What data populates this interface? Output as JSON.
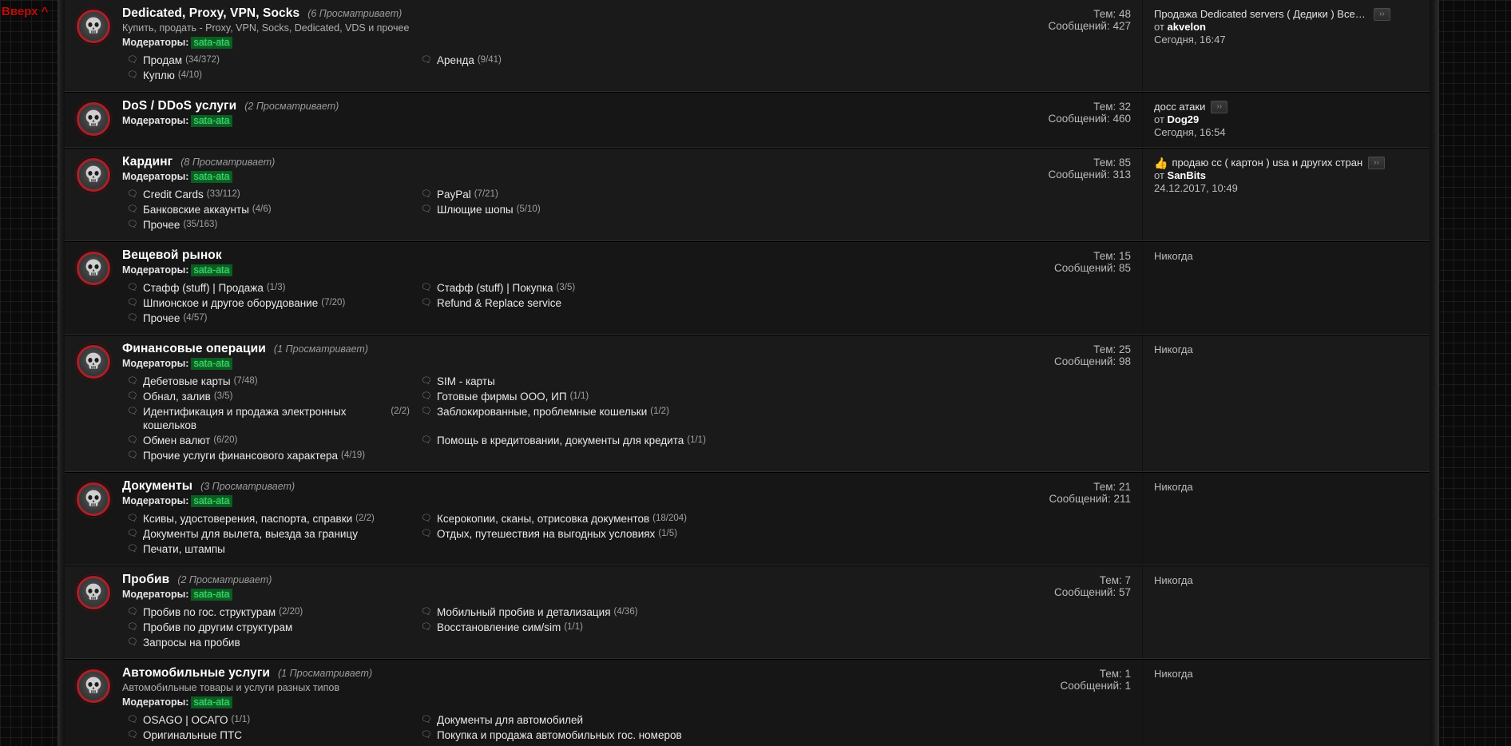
{
  "page": {
    "back_to_top": "Вверх ^",
    "viewers_suffix": "Просматривает",
    "mods_label": "Модераторы:",
    "threads_label": "Тем:",
    "posts_label": "Сообщений:",
    "by_label": "от",
    "never_label": "Никогда",
    "goto_last": "››",
    "accent_red": "#c10b0b",
    "mod_green": "#3be06b",
    "avatar_ring": "#a4232a"
  },
  "forums": [
    {
      "title": "Dedicated, Proxy, VPN, Socks",
      "viewers": "(6 Просматривает)",
      "desc": "Купить, продать - Proxy, VPN, Socks, Dedicated, VDS и прочее",
      "mods": "sata-ata",
      "subforums": [
        {
          "label": "Продам",
          "count": "(34/372)"
        },
        {
          "label": "Аренда",
          "count": "(9/41)"
        },
        {
          "label": "Куплю",
          "count": "(4/10)"
        }
      ],
      "threads": "Тем: 48",
      "posts": "Сообщений: 427",
      "last_post": {
        "never": false,
        "emoji": "",
        "title": "Продажа Dedicated servers ( Дедики ) Все Страны...",
        "has_goto": true,
        "by": "akvelon",
        "date": "Сегодня, 16:47"
      }
    },
    {
      "title": "DoS / DDoS услуги",
      "viewers": "(2 Просматривает)",
      "desc": "",
      "mods": "sata-ata",
      "subforums": [],
      "threads": "Тем: 32",
      "posts": "Сообщений: 460",
      "last_post": {
        "never": false,
        "emoji": "",
        "title": "досс атаки",
        "has_goto": true,
        "by": "Dog29",
        "date": "Сегодня, 16:54"
      }
    },
    {
      "title": "Кардинг",
      "viewers": "(8 Просматривает)",
      "desc": "",
      "mods": "sata-ata",
      "subforums": [
        {
          "label": "Credit Cards",
          "count": "(33/112)"
        },
        {
          "label": "PayPal",
          "count": "(7/21)"
        },
        {
          "label": "Банковские аккаунты",
          "count": "(4/6)"
        },
        {
          "label": "Шлющие шопы",
          "count": "(5/10)"
        },
        {
          "label": "Прочее",
          "count": "(35/163)"
        }
      ],
      "threads": "Тем: 85",
      "posts": "Сообщений: 313",
      "last_post": {
        "never": false,
        "emoji": "👍",
        "title": "продаю cc ( картон ) usa и других стран",
        "has_goto": true,
        "by": "SanBits",
        "date": "24.12.2017, 10:49"
      }
    },
    {
      "title": "Вещевой рынок",
      "viewers": "",
      "desc": "",
      "mods": "sata-ata",
      "subforums": [
        {
          "label": "Стафф (stuff) | Продажа",
          "count": "(1/3)"
        },
        {
          "label": "Стафф (stuff) | Покупка",
          "count": "(3/5)"
        },
        {
          "label": "Шпионское и другое оборудование",
          "count": "(7/20)"
        },
        {
          "label": "Refund & Replace service",
          "count": ""
        },
        {
          "label": "Прочее",
          "count": "(4/57)"
        }
      ],
      "threads": "Тем: 15",
      "posts": "Сообщений: 85",
      "last_post": {
        "never": true,
        "emoji": "",
        "title": "",
        "has_goto": false,
        "by": "",
        "date": ""
      }
    },
    {
      "title": "Финансовые операции",
      "viewers": "(1 Просматривает)",
      "desc": "",
      "mods": "sata-ata",
      "subforums": [
        {
          "label": "Дебетовые карты",
          "count": "(7/48)"
        },
        {
          "label": "SIM - карты",
          "count": ""
        },
        {
          "label": "Обнал, залив",
          "count": "(3/5)"
        },
        {
          "label": "Готовые фирмы ООО, ИП",
          "count": "(1/1)"
        },
        {
          "label": "Идентификация и продажа электронных кошельков",
          "count": "(2/2)"
        },
        {
          "label": "Заблокированные, проблемные кошельки",
          "count": "(1/2)"
        },
        {
          "label": "Обмен валют",
          "count": "(6/20)"
        },
        {
          "label": "Помощь в кредитовании, документы для кредита",
          "count": "(1/1)"
        },
        {
          "label": "Прочие услуги финансового характера",
          "count": "(4/19)"
        }
      ],
      "threads": "Тем: 25",
      "posts": "Сообщений: 98",
      "last_post": {
        "never": true,
        "emoji": "",
        "title": "",
        "has_goto": false,
        "by": "",
        "date": ""
      }
    },
    {
      "title": "Документы",
      "viewers": "(3 Просматривает)",
      "desc": "",
      "mods": "sata-ata",
      "subforums": [
        {
          "label": "Ксивы, удостоверения, паспорта, справки",
          "count": "(2/2)"
        },
        {
          "label": "Ксерокопии, сканы, отрисовка документов",
          "count": "(18/204)"
        },
        {
          "label": "Документы для вылета, выезда за границу",
          "count": ""
        },
        {
          "label": "Отдых, путешествия на выгодных условиях",
          "count": "(1/5)"
        },
        {
          "label": "Печати, штампы",
          "count": ""
        }
      ],
      "threads": "Тем: 21",
      "posts": "Сообщений: 211",
      "last_post": {
        "never": true,
        "emoji": "",
        "title": "",
        "has_goto": false,
        "by": "",
        "date": ""
      }
    },
    {
      "title": "Пробив",
      "viewers": "(2 Просматривает)",
      "desc": "",
      "mods": "sata-ata",
      "subforums": [
        {
          "label": "Пробив по гос. структурам",
          "count": "(2/20)"
        },
        {
          "label": "Мобильный пробив и детализация",
          "count": "(4/36)"
        },
        {
          "label": "Пробив по другим структурам",
          "count": ""
        },
        {
          "label": "Восстановление сим/sim",
          "count": "(1/1)"
        },
        {
          "label": "Запросы на пробив",
          "count": ""
        }
      ],
      "threads": "Тем: 7",
      "posts": "Сообщений: 57",
      "last_post": {
        "never": true,
        "emoji": "",
        "title": "",
        "has_goto": false,
        "by": "",
        "date": ""
      }
    },
    {
      "title": "Автомобильные услуги",
      "viewers": "(1 Просматривает)",
      "desc": "Автомобильные товары и услуги разных типов",
      "mods": "sata-ata",
      "subforums": [
        {
          "label": "OSAGO | ОСАГО",
          "count": "(1/1)"
        },
        {
          "label": "Документы для автомобилей",
          "count": ""
        },
        {
          "label": "Оригинальные ПТС",
          "count": ""
        },
        {
          "label": "Покупка и продажа автомобильных гос. номеров",
          "count": ""
        }
      ],
      "threads": "Тем: 1",
      "posts": "Сообщений: 1",
      "last_post": {
        "never": true,
        "emoji": "",
        "title": "",
        "has_goto": false,
        "by": "",
        "date": ""
      }
    }
  ]
}
